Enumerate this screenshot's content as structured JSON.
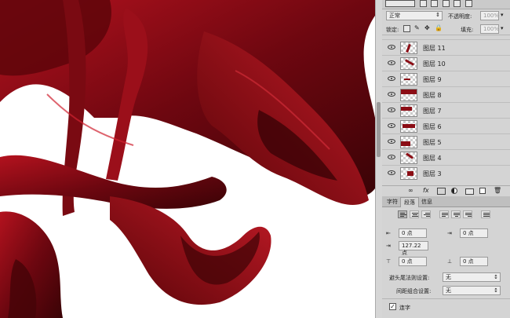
{
  "layers_panel": {
    "blend_mode": "正常",
    "opacity_label": "不透明度:",
    "opacity_value": "100%",
    "lock_label": "锁定:",
    "fill_label": "填充:",
    "fill_value": "100%",
    "layers": [
      {
        "name": "图层 11",
        "visible": true
      },
      {
        "name": "图层 10",
        "visible": true
      },
      {
        "name": "图层 9",
        "visible": true
      },
      {
        "name": "图层 8",
        "visible": true
      },
      {
        "name": "图层 7",
        "visible": true
      },
      {
        "name": "图层 6",
        "visible": true
      },
      {
        "name": "图层 5",
        "visible": true
      },
      {
        "name": "图层 4",
        "visible": true
      },
      {
        "name": "图层 3",
        "visible": true
      }
    ],
    "footer_icons": [
      "link-icon",
      "fx-icon",
      "mask-icon",
      "adjustment-icon",
      "group-icon",
      "new-layer-icon",
      "trash-icon"
    ]
  },
  "paragraph_panel": {
    "tabs": [
      "字符",
      "段落",
      "信息"
    ],
    "active_tab": "段落",
    "left_indent": "0 点",
    "right_indent": "0 点",
    "first_line_indent": "127.22 点",
    "space_before": "0 点",
    "space_after": "0 点",
    "kinsoku_label": "避头尾法则设置:",
    "kinsoku_value": "无",
    "mojikumi_label": "间距组合设置:",
    "mojikumi_value": "无",
    "hyphenate_label": "连字",
    "hyphenate_checked": true
  },
  "colors": {
    "fabric": "#8b0d15",
    "fabric_dark": "#4a0408",
    "panel_bg": "#d4d4d4"
  }
}
